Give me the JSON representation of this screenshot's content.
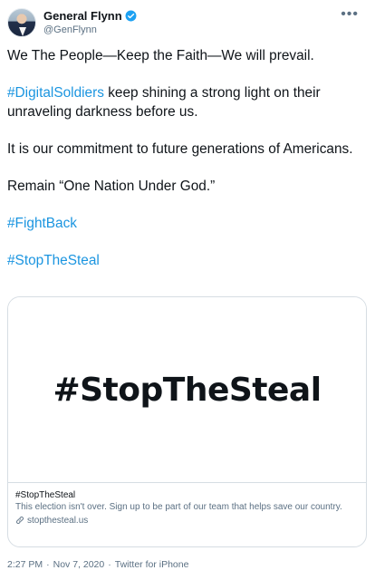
{
  "author": {
    "display_name": "General Flynn",
    "handle": "@GenFlynn",
    "verified": true
  },
  "menu": {
    "more_label": "•••"
  },
  "tweet": {
    "line1": "We The People—Keep the Faith—We will prevail.",
    "line2_hashtag": "#DigitalSoldiers",
    "line2_rest": " keep shining a strong light on their unraveling darkness before us.",
    "line3": "It is our commitment to future generations of Americans.",
    "line4": "Remain “One Nation Under God.”",
    "hashtag_fightback": "#FightBack",
    "hashtag_stopthesteal": "#StopTheSteal"
  },
  "card": {
    "image_text": "#StopTheSteal",
    "title": "#StopTheSteal",
    "description": "This election isn't over. Sign up to be part of our team that helps save our country.",
    "url": "stopthesteal.us"
  },
  "footer": {
    "time": "2:27 PM",
    "separator": "·",
    "date": "Nov 7, 2020",
    "source": "Twitter for iPhone"
  },
  "colors": {
    "link": "#1b95e0",
    "verified_badge": "#1da1f2",
    "secondary_text": "#5b7083",
    "border": "#d6dde3"
  },
  "icons": {
    "verified": "verified-badge-icon",
    "link": "link-icon",
    "more": "more-icon"
  }
}
